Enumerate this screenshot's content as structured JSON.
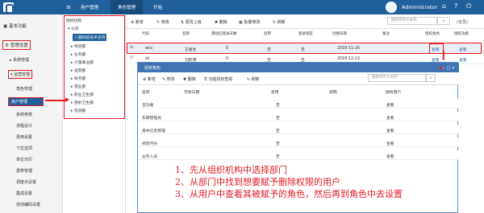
{
  "top_tabs": [
    {
      "label": "用户管理"
    },
    {
      "label": "角色管理"
    },
    {
      "label": "开始"
    }
  ],
  "user": {
    "name": "Administrator"
  },
  "sidebar": {
    "items": [
      {
        "label": "基本功能"
      },
      {
        "label": "管理设置"
      },
      {
        "label": "系统管理"
      },
      {
        "label": "运营管理"
      },
      {
        "label": "角色管理"
      },
      {
        "label": "用户管理"
      },
      {
        "label": "系统参数"
      },
      {
        "label": "流程设计"
      },
      {
        "label": "费用设置"
      },
      {
        "label": "下拉选项"
      },
      {
        "label": "单位日历"
      },
      {
        "label": "报表管理"
      },
      {
        "label": "调度点设置"
      },
      {
        "label": "集成设置"
      },
      {
        "label": "自动编码设置"
      }
    ]
  },
  "tree": {
    "title": "组织机构",
    "root": "公司",
    "items": [
      {
        "label": "八骏科技技术支持"
      },
      {
        "label": "综合部"
      },
      {
        "label": "业务部"
      },
      {
        "label": "计量事业部"
      },
      {
        "label": "运营部"
      },
      {
        "label": "财务部"
      },
      {
        "label": "营业部"
      },
      {
        "label": "职业卫生部"
      },
      {
        "label": "放射卫生部"
      },
      {
        "label": "检测部"
      }
    ]
  },
  "toolbar": {
    "new_label": "新增",
    "edit_label": "修改",
    "move_label": "更改上级",
    "delete_label": "删除",
    "batch_label": "批量修改",
    "refresh_label": "刷新",
    "search_placeholder": "搜索所有文本列",
    "scope_label": "(全员)"
  },
  "main_table": {
    "headers": [
      "代码",
      "名称",
      "需短信登录天数",
      "禁用",
      "登录锁定",
      "创建日期",
      "备注",
      "授权角色",
      "授权功能"
    ],
    "rows": [
      {
        "code": "wcs",
        "name": "王春生",
        "days": "0",
        "disabled": "否",
        "locked": "否",
        "created": "2018-11-26",
        "note": "",
        "role": "查看",
        "func": "查看"
      },
      {
        "code": "zk",
        "name": "刘凯明",
        "days": "0",
        "disabled": "否",
        "locked": "否",
        "created": "2018-12-13",
        "note": "",
        "role": "查看",
        "func": "查看"
      }
    ]
  },
  "modal": {
    "title": "授权角色",
    "toolbar": {
      "new_label": "新增",
      "edit_label": "修改",
      "delete_label": "删除",
      "assign_label": "功能授权查看",
      "refresh_label": "刷新",
      "search_placeholder": "搜索所有文本列"
    },
    "headers": [
      "名称",
      "无效日期",
      "禁用",
      "说明",
      "授权用户"
    ],
    "rows": [
      {
        "name": "全功能",
        "expire": "",
        "disabled": "否",
        "desc": "",
        "user": "查看"
      },
      {
        "name": "车辆管理员",
        "expire": "",
        "disabled": "否",
        "desc": "",
        "user": "查看"
      },
      {
        "name": "基本信息管理",
        "expire": "",
        "disabled": "否",
        "desc": "",
        "user": "查看"
      },
      {
        "name": "修改月份",
        "expire": "",
        "disabled": "否",
        "desc": "",
        "user": "查看"
      },
      {
        "name": "业务人员",
        "expire": "",
        "disabled": "否",
        "desc": "",
        "user": "查看"
      }
    ]
  },
  "instructions": [
    "1、先从组织机构中选择部门",
    "2、从部门中找到想要赋予删除权限的用户",
    "3、从用户中查看其被赋予的角色，然后再到角色中去设置"
  ],
  "colors": {
    "header": "#1f5f9b",
    "accent_red": "#e31b23",
    "modal_header": "#3f73b3"
  }
}
